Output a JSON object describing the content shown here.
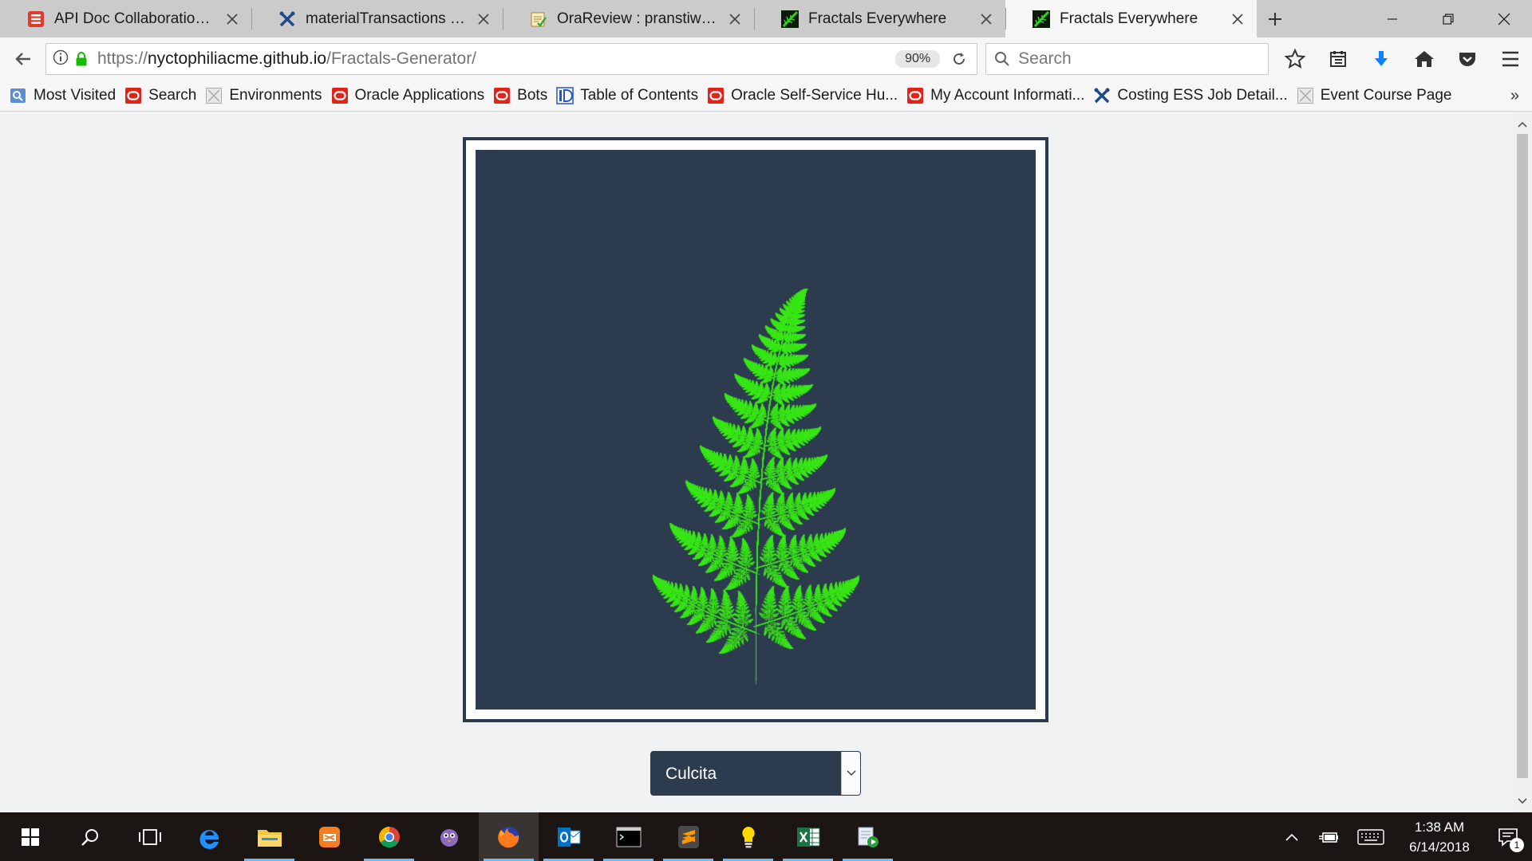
{
  "tabs": [
    {
      "title": "API Doc Collaboration > L...",
      "favicon": "oracle-red-doc-icon",
      "active": false
    },
    {
      "title": "materialTransactions - Fus...",
      "favicon": "x-tools-icon",
      "active": false
    },
    {
      "title": "OraReview : pranstiw_bug...",
      "favicon": "review-note-icon",
      "active": false
    },
    {
      "title": "Fractals Everywhere",
      "favicon": "fern-green-icon",
      "active": false
    },
    {
      "title": "Fractals Everywhere",
      "favicon": "fern-green-icon",
      "active": true
    }
  ],
  "navbar": {
    "url_prefix": "https://",
    "url_host": "nyctophiliacme.github.io",
    "url_path": "/Fractals-Generator/",
    "zoom": "90%",
    "search_placeholder": "Search"
  },
  "bookmarks": [
    {
      "label": "Most Visited",
      "icon": "most-visited-icon"
    },
    {
      "label": "Search",
      "icon": "oracle-icon"
    },
    {
      "label": "Environments",
      "icon": "generic-page-icon"
    },
    {
      "label": "Oracle Applications",
      "icon": "oracle-icon"
    },
    {
      "label": "Bots",
      "icon": "oracle-icon"
    },
    {
      "label": "Table of Contents",
      "icon": "id-icon"
    },
    {
      "label": "Oracle Self-Service Hu...",
      "icon": "oracle-icon"
    },
    {
      "label": "My Account Informati...",
      "icon": "oracle-icon"
    },
    {
      "label": "Costing ESS Job Detail...",
      "icon": "x-tools-icon"
    },
    {
      "label": "Event Course Page",
      "icon": "generic-page-icon"
    }
  ],
  "bookmarks_overflow": "»",
  "fractal": {
    "selected": "Culcita",
    "options": [
      "Culcita"
    ],
    "leaf_color": "#39e617",
    "canvas_bg": "#2d3b4f"
  },
  "clock": {
    "time": "1:38 AM",
    "date": "6/14/2018"
  },
  "notifications_count": "1",
  "colors": {
    "frame_border": "#2c3a4e",
    "page_bg": "#f0f2f4",
    "taskbar_bg": "#1b1613"
  }
}
